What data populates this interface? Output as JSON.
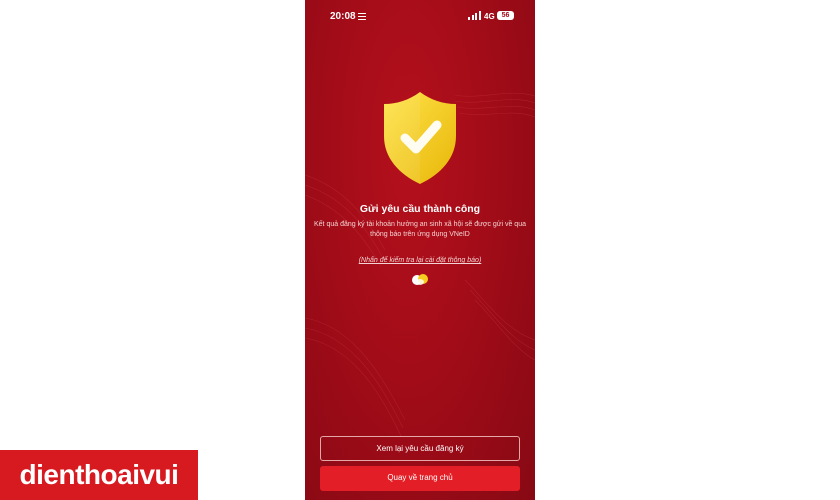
{
  "status_bar": {
    "time": "20:08",
    "network": "4G",
    "battery": "56"
  },
  "result": {
    "title": "Gửi yêu cầu thành công",
    "description": "Kết quả đăng ký tài khoản hưởng an sinh xã hội sẽ được gửi về qua thông báo trên ứng dụng VNeID",
    "settings_link": "(Nhấn để kiểm tra lại cài đặt thông báo)"
  },
  "actions": {
    "review_label": "Xem lại yêu cầu đăng ký",
    "home_label": "Quay về trang chủ"
  },
  "watermark": {
    "brand": "dienthoaivui"
  },
  "colors": {
    "background": "#a20c18",
    "primary_button": "#e31e26",
    "shield": "#f6cf1e",
    "brand_bar": "#d71920"
  },
  "icons": {
    "shield": "shield-check-icon",
    "loading": "loading-icon"
  }
}
